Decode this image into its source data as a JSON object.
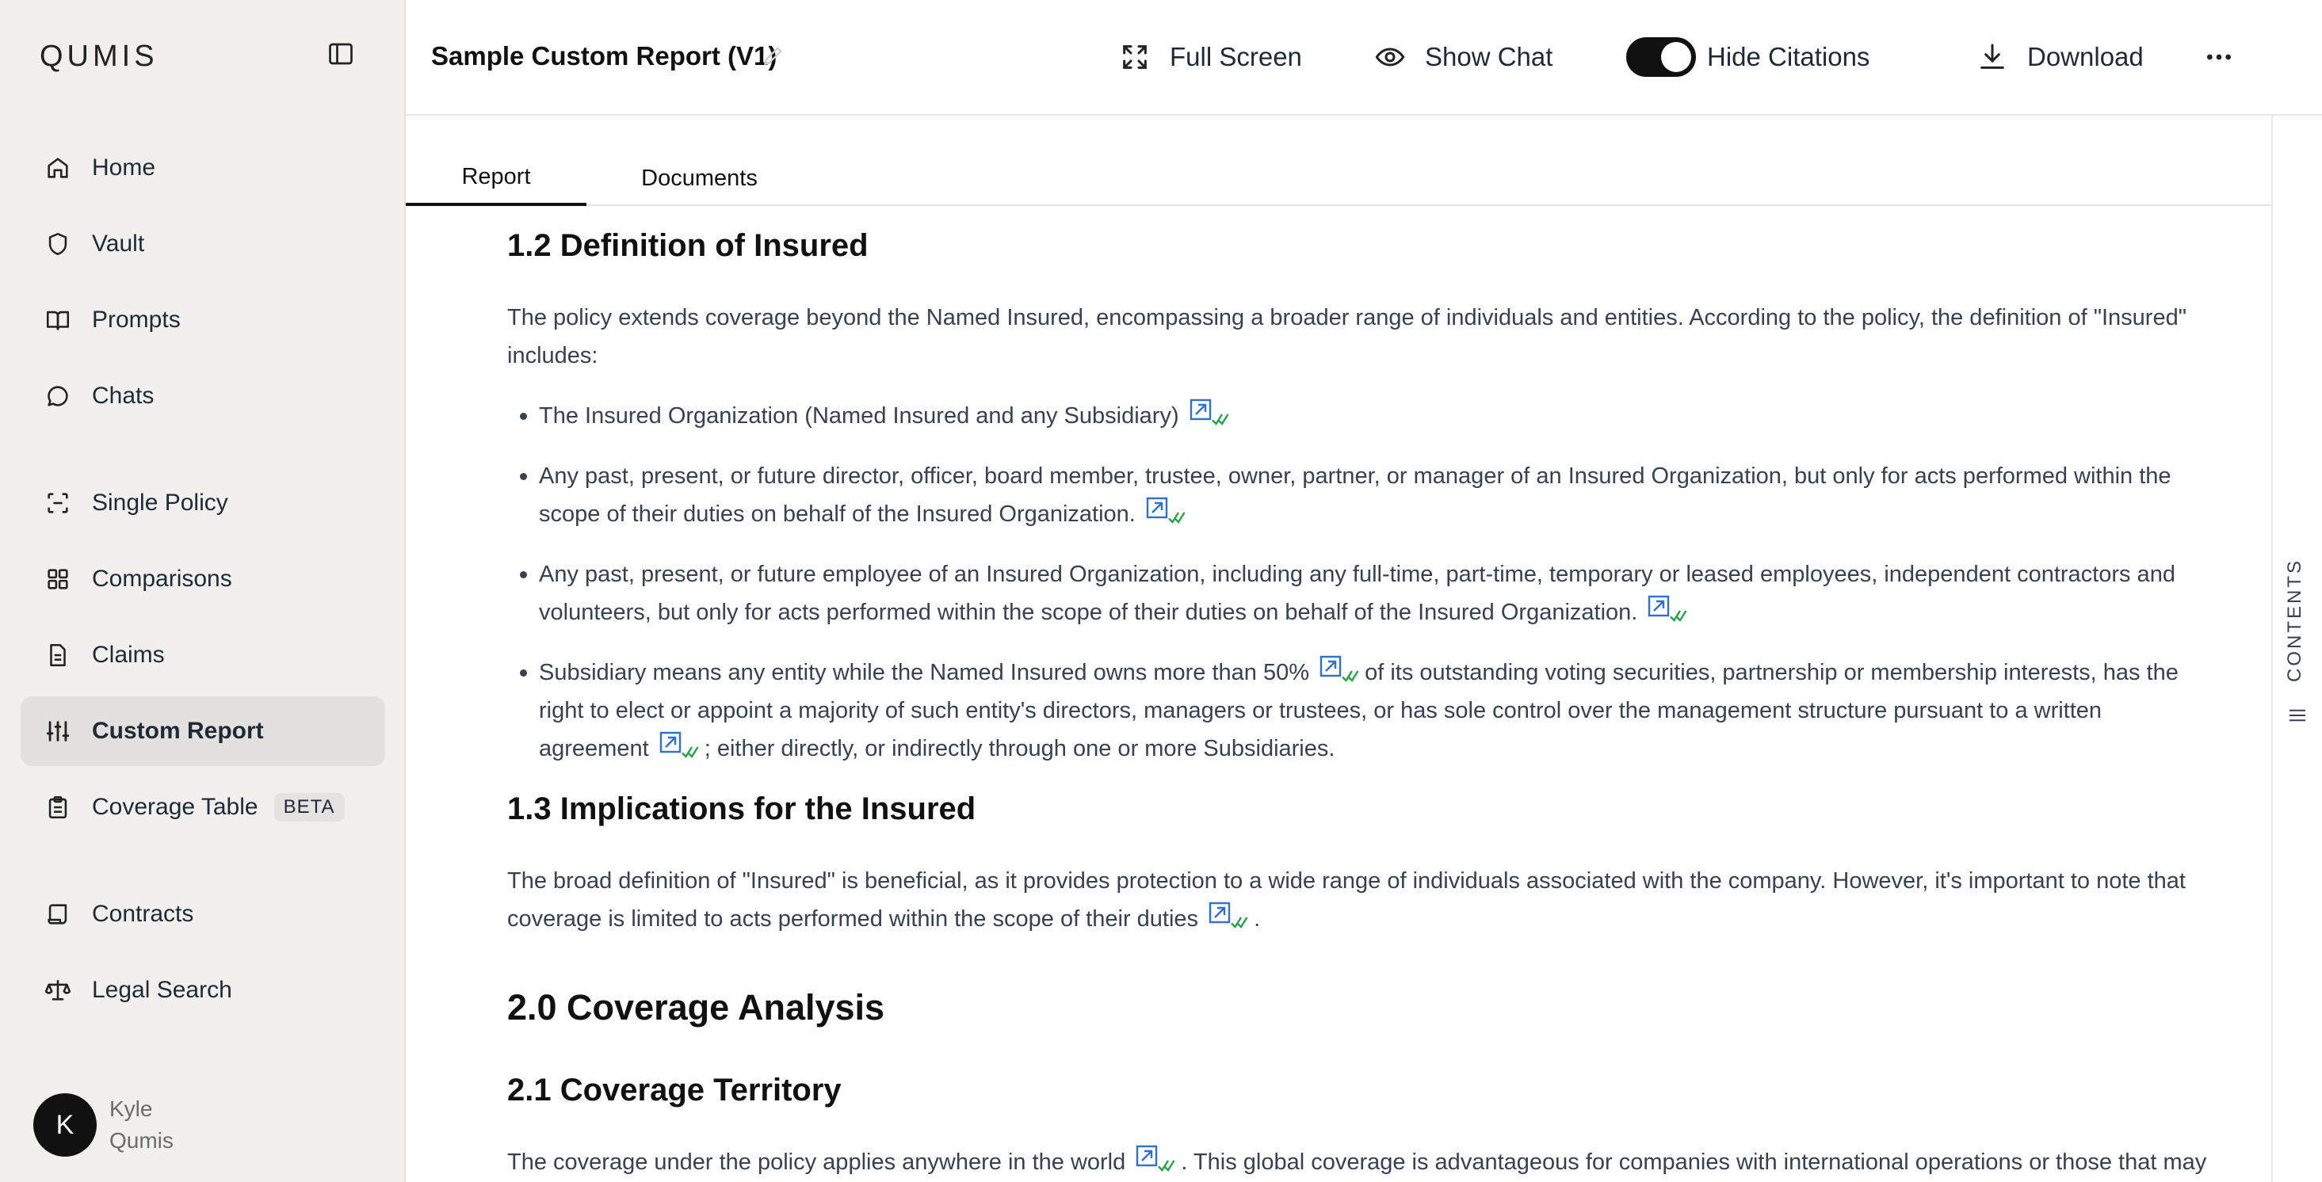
{
  "sidebar": {
    "logo": "QUMIS",
    "nav": [
      {
        "label": "Home",
        "icon": "home-icon"
      },
      {
        "label": "Vault",
        "icon": "shield-icon"
      },
      {
        "label": "Prompts",
        "icon": "book-icon"
      },
      {
        "label": "Chats",
        "icon": "chat-icon"
      },
      {
        "label": "Single Policy",
        "icon": "scan-icon"
      },
      {
        "label": "Comparisons",
        "icon": "grid-icon"
      },
      {
        "label": "Claims",
        "icon": "document-icon"
      },
      {
        "label": "Custom Report",
        "icon": "sliders-icon",
        "active": true
      },
      {
        "label": "Coverage Table",
        "icon": "clipboard-icon",
        "badge": "BETA"
      },
      {
        "label": "Contracts",
        "icon": "scroll-icon"
      },
      {
        "label": "Legal Search",
        "icon": "scale-icon"
      }
    ],
    "user": {
      "initial": "K",
      "first": "Kyle",
      "last": "Qumis"
    }
  },
  "header": {
    "title": "Sample Custom Report (V1)",
    "full_screen": "Full Screen",
    "show_chat": "Show Chat",
    "hide_citations": "Hide Citations",
    "hide_citations_on": true,
    "download": "Download"
  },
  "tabs": {
    "report": "Report",
    "documents": "Documents",
    "active": "Report"
  },
  "rail": {
    "label": "CONTENTS"
  },
  "content": {
    "s12_title": "1.2 Definition of Insured",
    "s12_intro": "The policy extends coverage beyond the Named Insured, encompassing a broader range of individuals and entities. According to the policy, the definition of \"Insured\" includes:",
    "b1": "The Insured Organization (Named Insured and any Subsidiary)",
    "b2": "Any past, present, or future director, officer, board member, trustee, owner, partner, or manager of an Insured Organization, but only for acts performed within the scope of their duties on behalf of the Insured Organization.",
    "b3": "Any past, present, or future employee of an Insured Organization, including any full-time, part-time, temporary or leased employees, independent contractors and volunteers, but only for acts performed within the scope of their duties on behalf of the Insured Organization.",
    "b4a": "Subsidiary means any entity while the Named Insured owns more than 50%",
    "b4b": "of its outstanding voting securities, partnership or membership interests, has the right to elect or appoint a majority of such entity's directors, managers or trustees, or has sole control over the management structure pursuant to a written agreement",
    "b4c": "; either directly, or indirectly through one or more Subsidiaries.",
    "s13_title": "1.3 Implications for the Insured",
    "s13_a": "The broad definition of \"Insured\" is beneficial, as it provides protection to a wide range of individuals associated with the company. However, it's important to note that coverage is limited to acts performed within the scope of their duties",
    "s13_b": ".",
    "s20_title": "2.0 Coverage Analysis",
    "s21_title": "2.1 Coverage Territory",
    "s21_a": "The coverage under the policy applies anywhere in the world",
    "s21_b": ". This global coverage is advantageous for companies with international operations or those that may face"
  },
  "colors": {
    "cite_blue": "#2f6fd6",
    "cite_green": "#22a447",
    "sidebar_bg": "#f1f0ed"
  }
}
